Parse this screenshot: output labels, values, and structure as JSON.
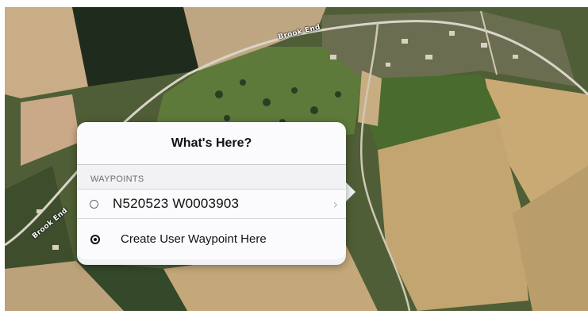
{
  "map": {
    "road_labels": [
      "Brook End",
      "Brook End"
    ]
  },
  "popup": {
    "title": "What's Here?",
    "section_label": "WAYPOINTS",
    "items": [
      {
        "label": "N520523 W0003903",
        "icon": "radio-circle-icon",
        "has_chevron": true
      },
      {
        "label": "Create User Waypoint Here",
        "icon": "target-icon",
        "has_chevron": false
      }
    ]
  },
  "colors": {
    "popup_bg": "#f2f2f5",
    "text": "#111111"
  }
}
